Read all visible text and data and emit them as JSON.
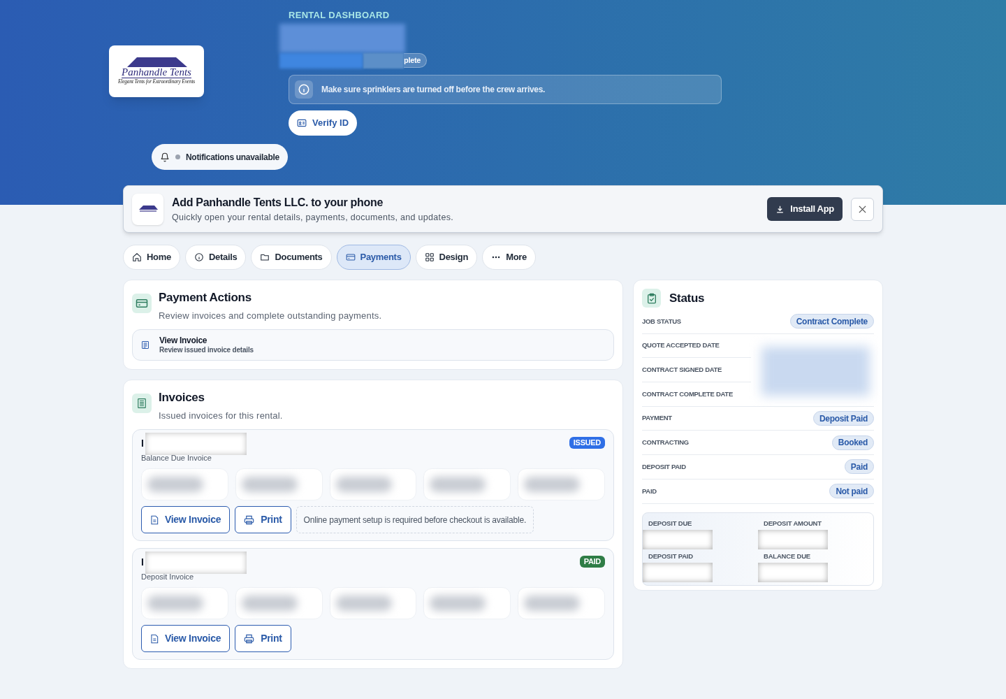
{
  "header": {
    "logo": {
      "name": "Panhandle Tents",
      "tagline": "Elegant Tents for Extraordinary Events"
    },
    "eyebrow": "RENTAL DASHBOARD",
    "badge": "plete",
    "alert": "Make sure sprinklers are turned off before the crew arrives.",
    "verify_button": "Verify ID",
    "notifications": "Notifications unavailable"
  },
  "install_banner": {
    "title": "Add Panhandle Tents LLC. to your phone",
    "subtitle": "Quickly open your rental details, payments, documents, and updates.",
    "button": "Install App"
  },
  "tabs": [
    {
      "label": "Home",
      "kind": "home",
      "selected": false
    },
    {
      "label": "Details",
      "kind": "info",
      "selected": false
    },
    {
      "label": "Documents",
      "kind": "folder",
      "selected": false
    },
    {
      "label": "Payments",
      "kind": "card",
      "selected": true
    },
    {
      "label": "Design",
      "kind": "grid",
      "selected": false
    },
    {
      "label": "More",
      "kind": "dots",
      "selected": false
    }
  ],
  "payment_actions": {
    "title": "Payment Actions",
    "subtitle": "Review invoices and complete outstanding payments.",
    "action": {
      "title": "View Invoice",
      "subtitle": "Review issued invoice details"
    }
  },
  "invoices": {
    "title": "Invoices",
    "subtitle": "Issued invoices for this rental.",
    "items": [
      {
        "title": "I",
        "subtitle": "Balance Due Invoice",
        "status": "ISSUED",
        "color": "#2f6fe6",
        "buttons": [
          "View Invoice",
          "Print"
        ],
        "note": "Online payment setup is required before checkout is available."
      },
      {
        "title": "I",
        "subtitle": "Deposit Invoice",
        "status": "PAID",
        "color": "#2f7d46",
        "buttons": [
          "View Invoice",
          "Print"
        ]
      }
    ]
  },
  "status": {
    "title": "Status",
    "rows": [
      {
        "label": "JOB STATUS",
        "kind": "pill",
        "value": "Contract Complete"
      },
      {
        "label": "QUOTE ACCEPTED DATE",
        "kind": "hidden"
      },
      {
        "label": "CONTRACT SIGNED DATE",
        "kind": "hidden"
      },
      {
        "label": "CONTRACT COMPLETE DATE",
        "kind": "hidden"
      },
      {
        "label": "PAYMENT",
        "kind": "pill",
        "value": "Deposit Paid"
      },
      {
        "label": "CONTRACTING",
        "kind": "pill",
        "value": "Booked"
      },
      {
        "label": "DEPOSIT PAID",
        "kind": "pill",
        "value": "Paid"
      },
      {
        "label": "PAID",
        "kind": "pill",
        "value": "Not paid"
      }
    ],
    "summary": [
      "DEPOSIT DUE",
      "DEPOSIT AMOUNT",
      "DEPOSIT PAID",
      "BALANCE DUE"
    ]
  }
}
